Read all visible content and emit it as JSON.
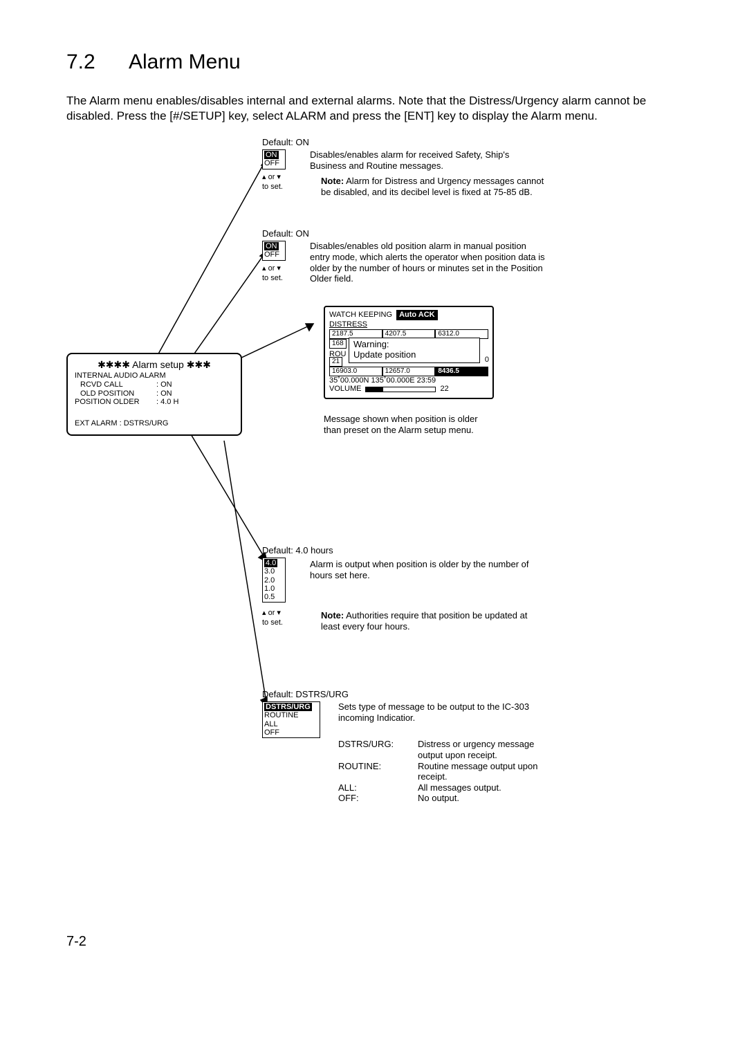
{
  "section_number": "7.2",
  "section_title": "Alarm Menu",
  "intro": "The Alarm menu enables/disables internal and external alarms. Note that the Distress/Urgency alarm cannot be disabled. Press the [#/SETUP] key, select ALARM and press the [ENT] key to display the Alarm menu.",
  "alarmbox": {
    "title_prefix": "✱✱✱✱",
    "title": "Alarm setup",
    "title_suffix": "✱✱✱",
    "header1": "INTERNAL AUDIO ALARM",
    "row1_label": "RCVD CALL",
    "row1_val": ": ON",
    "row2_label": "OLD POSITION",
    "row2_val": ": ON",
    "row3_label": "POSITION OLDER",
    "row3_val": ": 4.0 H",
    "footer": "EXT ALARM : DSTRS/URG"
  },
  "block1": {
    "default": "Default: ON",
    "option_sel": "ON",
    "option_other": "OFF",
    "arrows": "▴ or ▾",
    "toset": "to set.",
    "desc": "Disables/enables alarm for received Safety, Ship's Business and Routine messages.",
    "note_label": "Note:",
    "note": "Alarm for Distress and Urgency messages cannot be disabled, and its decibel level is fixed at 75-85 dB."
  },
  "block2": {
    "default": "Default: ON",
    "option_sel": "ON",
    "option_other": "OFF",
    "arrows": "▴ or ▾",
    "toset": "to set.",
    "desc": "Disables/enables old position alarm in manual position entry mode, which alerts the operator when position data is older by the number of hours or minutes set in the Position Older field."
  },
  "watch": {
    "heading": "WATCH KEEPING",
    "autoack": "Auto ACK",
    "distress": "DISTRESS",
    "r1a": "2187.5",
    "r1b": "4207.5",
    "r1c": "6312.0",
    "r2a": "168",
    "warn1": "Warning:",
    "warn2": "Update position",
    "rou": "ROU",
    "r3a": "21",
    "endnum": "0",
    "r4a": "16903.0",
    "r4b": "12657.0",
    "r4c": "8436.5",
    "posline": "35˚00.000N 135˚00.000E 23:59",
    "volume": "VOLUME",
    "vol_val": "22",
    "caption": "Message shown when position is older than preset on the Alarm setup menu."
  },
  "block3": {
    "default": "Default: 4.0 hours",
    "options": [
      "4.0",
      "3.0",
      "2.0",
      "1.0",
      "0.5"
    ],
    "arrows": "▴ or ▾",
    "toset": "to set.",
    "desc": "Alarm is output when position is older by the number of hours set here.",
    "note_label": "Note:",
    "note": "Authorities require that position be updated at least every four hours."
  },
  "block4": {
    "default": "Default: DSTRS/URG",
    "options_sel": "DSTRS/URG",
    "options": [
      "ROUTINE",
      "ALL",
      "OFF"
    ],
    "desc": "Sets type of message to be output to the IC-303 incoming Indicatior.",
    "t1k": "DSTRS/URG:",
    "t1v": "Distress or urgency message output upon receipt.",
    "t2k": "ROUTINE:",
    "t2v": "Routine message output upon receipt.",
    "t3k": "ALL:",
    "t3v": "All messages output.",
    "t4k": "OFF:",
    "t4v": "No output."
  },
  "page_number": "7-2"
}
